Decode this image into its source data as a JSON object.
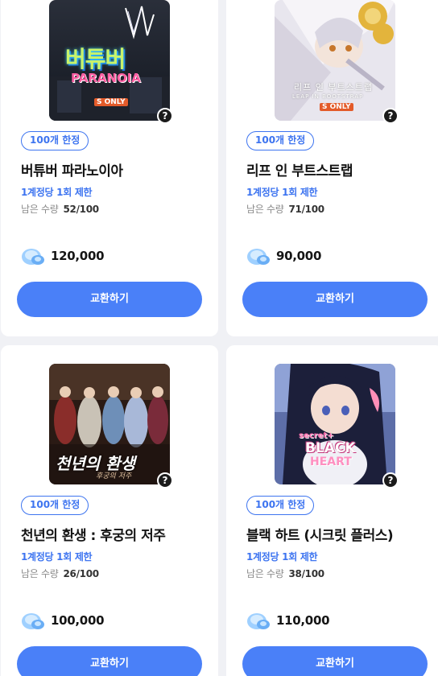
{
  "colors": {
    "accent": "#3d74f0",
    "button": "#4a80f8",
    "background": "#f0f1f5"
  },
  "products": [
    {
      "badge": "100개 한정",
      "title": "버튜버 파라노이아",
      "limit": "1계정당 1회 제한",
      "remain_label": "남은 수량",
      "remain_count": "52/100",
      "price": "120,000",
      "button": "교환하기",
      "thumb_text": [
        "버튜버",
        "PARANOIA",
        "S ONLY"
      ],
      "help": "?"
    },
    {
      "badge": "100개 한정",
      "title": "리프 인 부트스트랩",
      "limit": "1계정당 1회 제한",
      "remain_label": "남은 수량",
      "remain_count": "71/100",
      "price": "90,000",
      "button": "교환하기",
      "thumb_text": [
        "리프 인 부트스트랩",
        "LEAP IN BOOTSTRAP",
        "S ONLY"
      ],
      "help": "?"
    },
    {
      "badge": "100개 한정",
      "title": "천년의 환생 : 후궁의 저주",
      "limit": "1계정당 1회 제한",
      "remain_label": "남은 수량",
      "remain_count": "26/100",
      "price": "100,000",
      "button": "교환하기",
      "thumb_text": [
        "천년의 환생",
        "후궁의 저주"
      ],
      "help": "?"
    },
    {
      "badge": "100개 한정",
      "title": "블랙 하트 (시크릿 플러스)",
      "limit": "1계정당 1회 제한",
      "remain_label": "남은 수량",
      "remain_count": "38/100",
      "price": "110,000",
      "button": "교환하기",
      "thumb_text": [
        "secret+",
        "BLACK",
        "HEART"
      ],
      "help": "?"
    }
  ]
}
